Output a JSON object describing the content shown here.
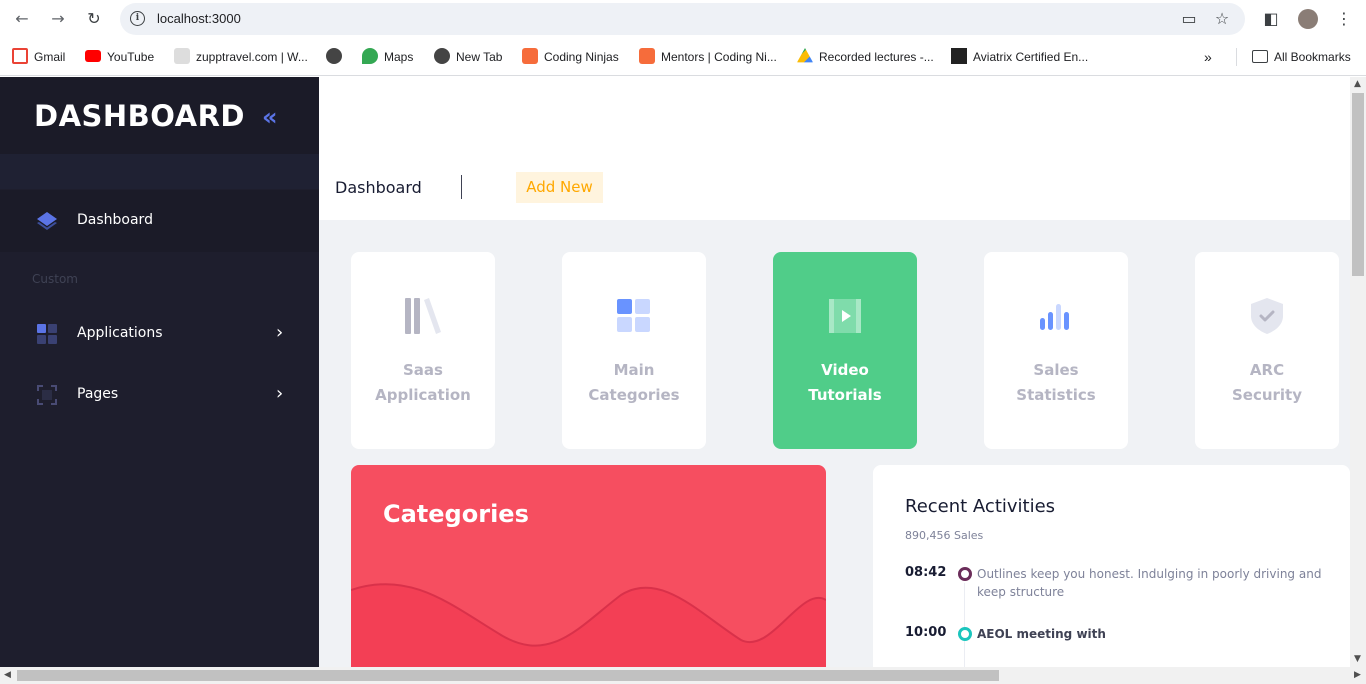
{
  "browser": {
    "url": "localhost:3000",
    "bookmarks": [
      {
        "label": "Gmail",
        "color": "#ea4335"
      },
      {
        "label": "YouTube",
        "color": "#ff0000"
      },
      {
        "label": "zupptravel.com | W...",
        "color": "#555555"
      },
      {
        "label": "",
        "color": "#444444"
      },
      {
        "label": "Maps",
        "color": "#34a853"
      },
      {
        "label": "New Tab",
        "color": "#444444"
      },
      {
        "label": "Coding Ninjas",
        "color": "#f66c3b"
      },
      {
        "label": "Mentors | Coding Ni...",
        "color": "#f66c3b"
      },
      {
        "label": "Recorded lectures -...",
        "color": "#4285f4"
      },
      {
        "label": "Aviatrix Certified En...",
        "color": "#e8501f"
      }
    ],
    "all_bookmarks": "All Bookmarks"
  },
  "sidebar": {
    "title": "DASHBOARD",
    "section_label": "Custom",
    "items": [
      {
        "label": "Dashboard"
      },
      {
        "label": "Applications"
      },
      {
        "label": "Pages"
      }
    ]
  },
  "subheader": {
    "title": "Dashboard",
    "add_new": "Add New"
  },
  "tiles": [
    {
      "line1": "Saas",
      "line2": "Application",
      "icon": "library-icon"
    },
    {
      "line1": "Main",
      "line2": "Categories",
      "icon": "grid-icon"
    },
    {
      "line1": "Video",
      "line2": "Tutorials",
      "icon": "video-icon"
    },
    {
      "line1": "Sales",
      "line2": "Statistics",
      "icon": "bar-chart-icon"
    },
    {
      "line1": "ARC",
      "line2": "Security",
      "icon": "shield-icon"
    }
  ],
  "categories_card": {
    "title": "Categories"
  },
  "recent": {
    "title": "Recent Activities",
    "subtitle": "890,456 Sales",
    "items": [
      {
        "time": "08:42",
        "text": "Outlines keep you honest. Indulging in poorly driving and keep structure",
        "dot_color": "#7337ee"
      },
      {
        "time": "10:00",
        "text": "AEOL meeting with",
        "dot_color": "#1bc5bd"
      }
    ]
  },
  "colors": {
    "sidebar_bg": "#1e1e2d",
    "accent_green": "#50cd89",
    "accent_red": "#f64e60",
    "accent_blue": "#5b74e6",
    "add_new_fg": "#ffa800"
  }
}
